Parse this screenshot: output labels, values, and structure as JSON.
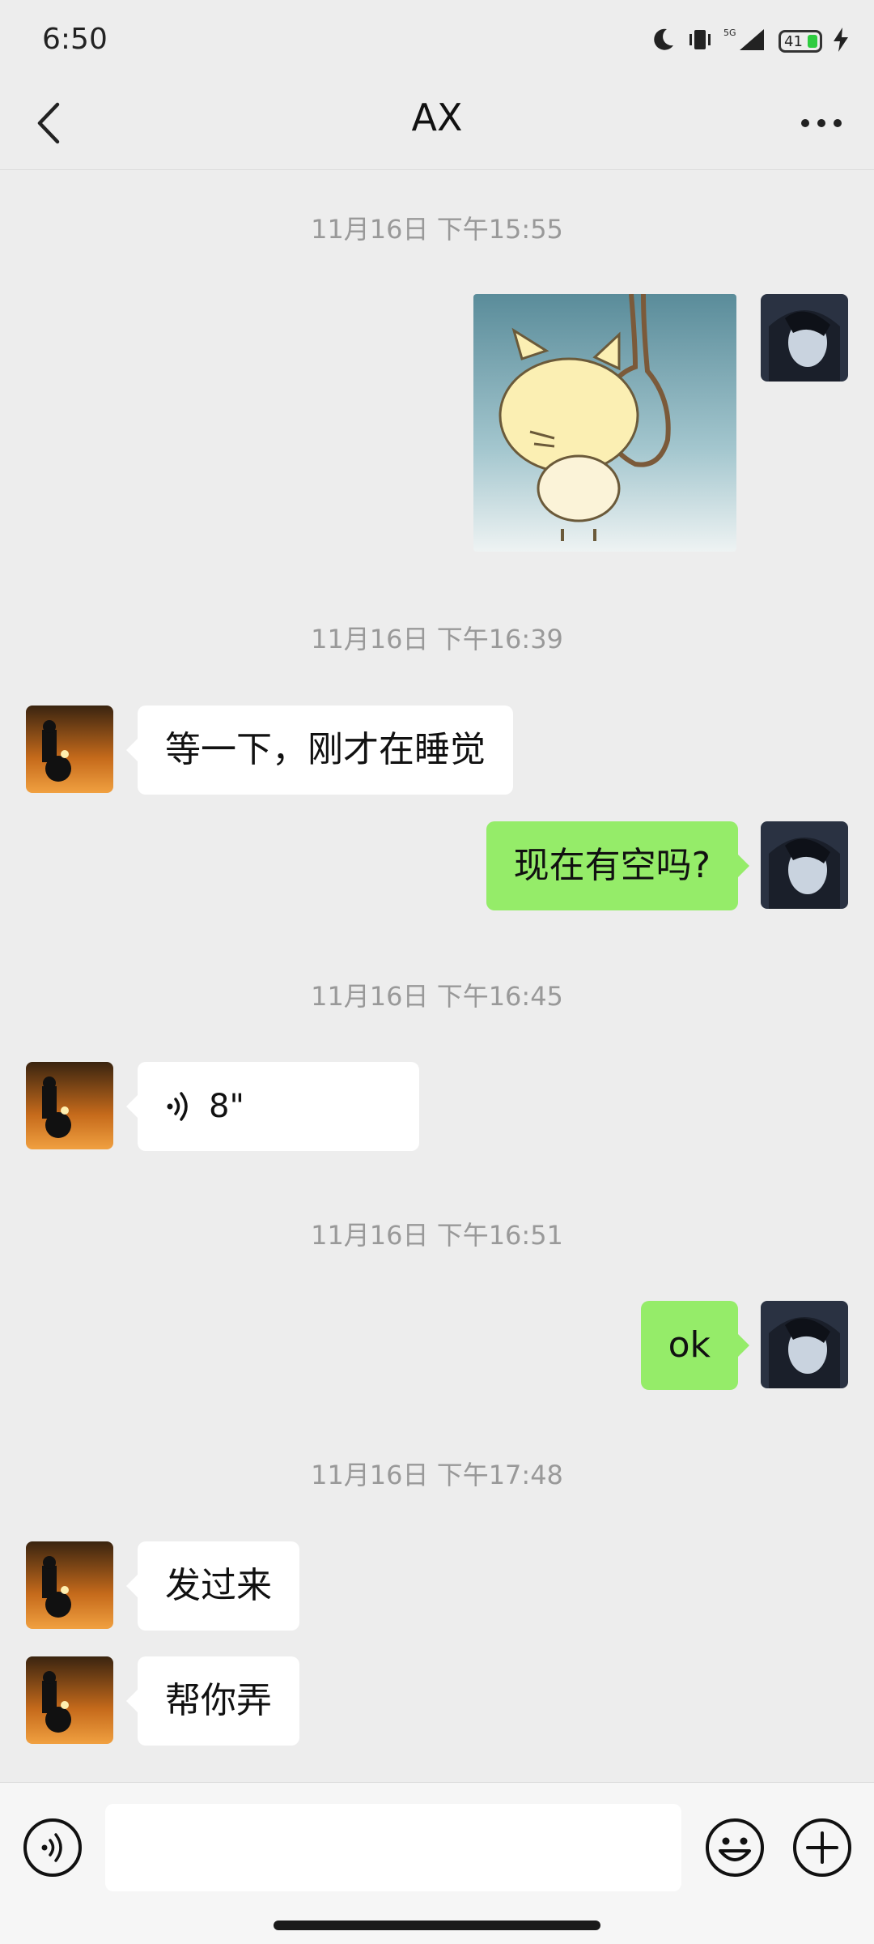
{
  "status": {
    "time": "6:50",
    "battery": "41",
    "network": "5G"
  },
  "header": {
    "title": "AX"
  },
  "messages": {
    "ts1": "11月16日 下午15:55",
    "ts2": "11月16日 下午16:39",
    "msg1": "等一下，刚才在睡觉",
    "msg2": "现在有空吗?",
    "ts3": "11月16日 下午16:45",
    "voice_len": "8\"",
    "ts4": "11月16日 下午16:51",
    "msg3": "ok",
    "ts5": "11月16日 下午17:48",
    "msg4": "发过来",
    "msg5": "帮你弄"
  },
  "input": {
    "placeholder": ""
  },
  "colors": {
    "background": "#ededed",
    "out_bubble": "#95ec69",
    "in_bubble": "#ffffff"
  }
}
